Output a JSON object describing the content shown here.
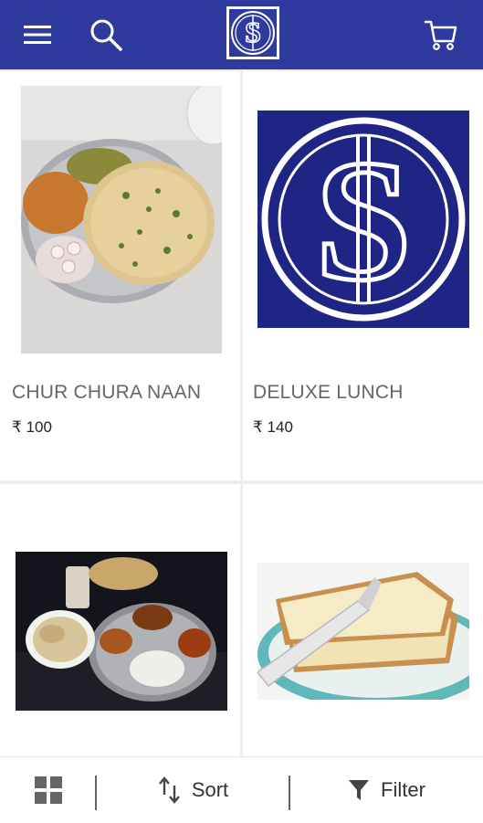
{
  "colors": {
    "primary": "#2f3a9e",
    "white": "#ffffff"
  },
  "header": {
    "menu_icon": "menu-icon",
    "search_icon": "search-icon",
    "logo": "dollar-logo",
    "cart_icon": "cart-icon"
  },
  "products": [
    {
      "name": "CHUR CHURA NAAN",
      "price": "₹ 100",
      "image": "naan-thali-photo"
    },
    {
      "name": "DELUXE LUNCH",
      "price": "₹ 140",
      "image": "dollar-logo-photo"
    },
    {
      "name": "",
      "price": "",
      "image": "dinner-thali-photo"
    },
    {
      "name": "",
      "price": "",
      "image": "butter-toast-photo"
    }
  ],
  "bottom_bar": {
    "grid_icon": "grid-view-icon",
    "sort_label": "Sort",
    "filter_label": "Filter"
  }
}
